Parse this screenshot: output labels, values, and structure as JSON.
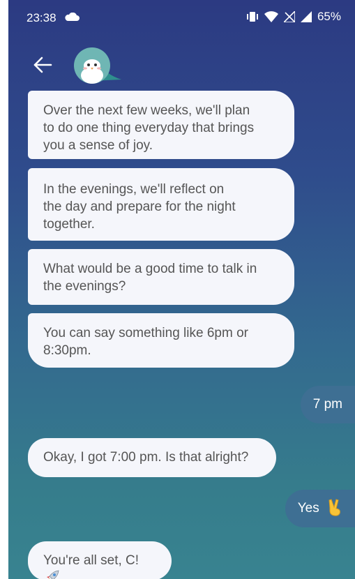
{
  "status_bar": {
    "time": "23:38",
    "battery": "65%",
    "icons": [
      "cloud-icon",
      "vibrate-icon",
      "wifi-icon",
      "no-sim-icon",
      "signal-icon"
    ]
  },
  "header": {
    "back_icon": "arrow-left-icon",
    "avatar": "penguin-avatar"
  },
  "messages": [
    {
      "from": "bot",
      "text_lines": [
        "Over the next few weeks, we'll plan",
        "to do one thing everyday that brings",
        "you a sense of joy."
      ]
    },
    {
      "from": "bot",
      "text_lines": [
        "In the evenings, we'll reflect on",
        "the day and prepare for the night",
        "together."
      ]
    },
    {
      "from": "bot",
      "text_lines": [
        "What would be a good time to talk in",
        "the evenings?"
      ]
    },
    {
      "from": "bot",
      "text_lines": [
        "You can say something like 6pm or",
        "8:30pm."
      ]
    },
    {
      "from": "user",
      "text": "7 pm"
    },
    {
      "from": "bot",
      "text_lines": [
        "Okay, I got 7:00 pm. Is that alright?"
      ]
    },
    {
      "from": "user",
      "text": "Yes",
      "emoji": "victory-hand-icon"
    },
    {
      "from": "bot",
      "text_lines": [
        "You're all set, C!"
      ],
      "emoji": "rocket-icon"
    }
  ],
  "colors": {
    "bg_top": "#2c3a82",
    "bg_bottom": "#388390",
    "bot_bubble": "#f5f6fb",
    "user_bubble": "#3e6f93"
  }
}
